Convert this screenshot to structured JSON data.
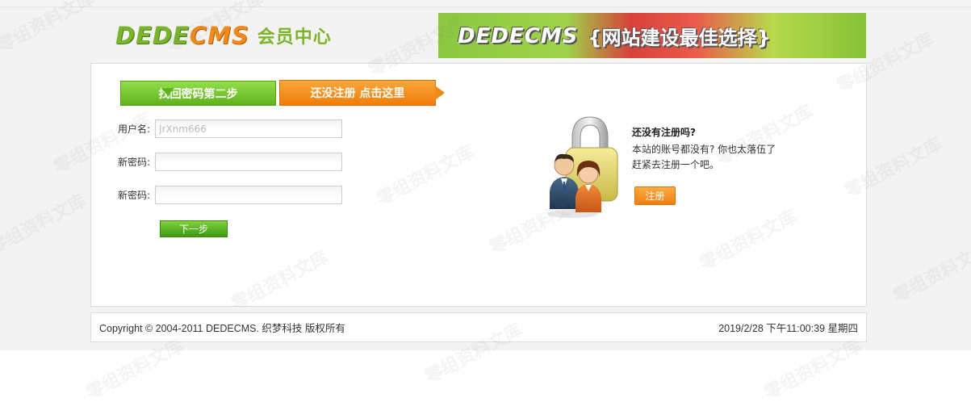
{
  "header": {
    "logo_dede": "DEDE",
    "logo_cms": "CMS",
    "logo_sub": "会员中心",
    "banner_dede": "DEDECMS",
    "banner_slogan": "{网站建设最佳选择}"
  },
  "tabs": {
    "step": "找回密码第二步",
    "register": "还没注册 点击这里"
  },
  "form": {
    "username_label": "用户名:",
    "username_placeholder": "JrXnm666",
    "password_label": "新密码:",
    "password_value": "",
    "confirm_label": "新密码:",
    "confirm_value": "",
    "next_button": "下一步"
  },
  "promo": {
    "title": "还没有注册吗?",
    "text": "本站的账号都没有? 你也太落伍了 赶紧去注册一个吧。",
    "register_button": "注册",
    "icon": "lock-users-icon"
  },
  "footer": {
    "copyright": "Copyright © 2004-2011 DEDECMS. 织梦科技 版权所有",
    "datetime": "2019/2/28 下午11:00:39 星期四"
  },
  "watermark_text": "零组资料文库",
  "colors": {
    "green": "#6ac22a",
    "orange": "#f08a17"
  }
}
